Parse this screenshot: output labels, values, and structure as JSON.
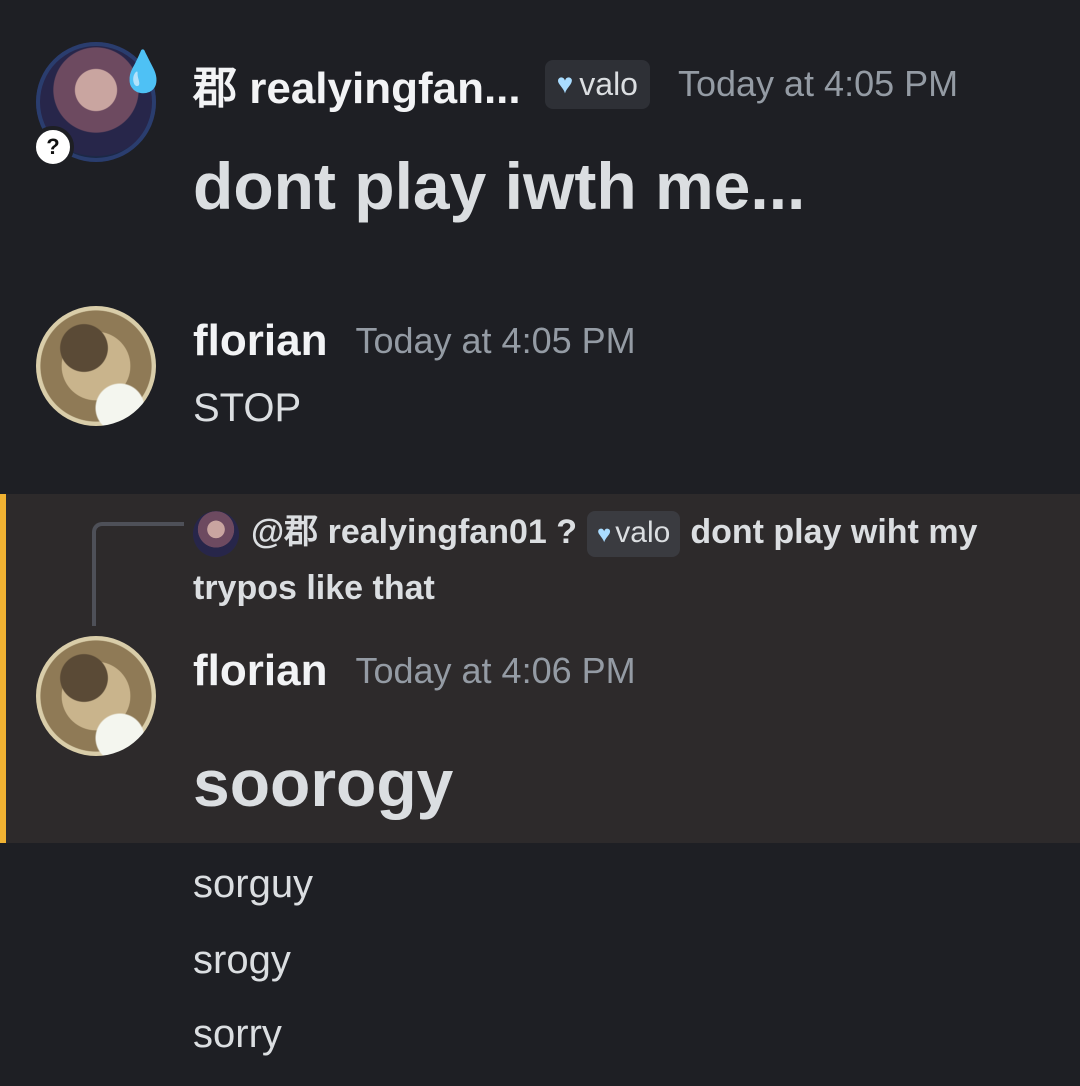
{
  "messages": [
    {
      "author": "郡 realyingfan...",
      "tag": "valo",
      "tag_icon": "heart-icon",
      "timestamp": "Today at 4:05 PM",
      "text": "dont play iwth me..."
    },
    {
      "author": "florian",
      "timestamp": "Today at 4:05 PM",
      "text": "STOP"
    },
    {
      "reply": {
        "mention": "@郡 realyingfan01",
        "status": "?",
        "tag": "valo",
        "text": "dont play wiht my trypos like that"
      },
      "author": "florian",
      "timestamp": "Today at 4:06 PM",
      "text": "soorogy"
    }
  ],
  "followups": [
    "sorguy",
    "srogy",
    "sorry"
  ],
  "status_icon": "?",
  "colors": {
    "background": "#1e1f24",
    "highlight": "#2d2a2b",
    "highlight_bar": "#f0b232",
    "timestamp": "#949ba4"
  }
}
